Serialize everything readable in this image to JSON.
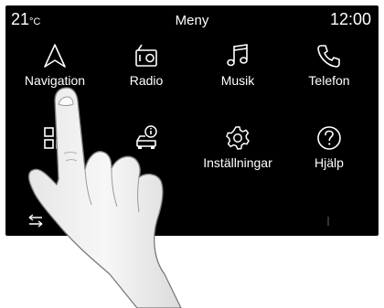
{
  "status_bar": {
    "temperature": "21",
    "temperature_unit": "°C",
    "title": "Meny",
    "clock": "12:00"
  },
  "menu": {
    "items": [
      {
        "label": "Navigation",
        "icon": "navigation-arrow-icon"
      },
      {
        "label": "Radio",
        "icon": "radio-icon"
      },
      {
        "label": "Musik",
        "icon": "music-note-icon"
      },
      {
        "label": "Telefon",
        "icon": "phone-icon"
      },
      {
        "label": "",
        "icon": "apps-grid-icon"
      },
      {
        "label": "",
        "icon": "vehicle-info-icon"
      },
      {
        "label": "Inställningar",
        "icon": "gear-icon"
      },
      {
        "label": "Hjälp",
        "icon": "help-icon"
      }
    ]
  }
}
